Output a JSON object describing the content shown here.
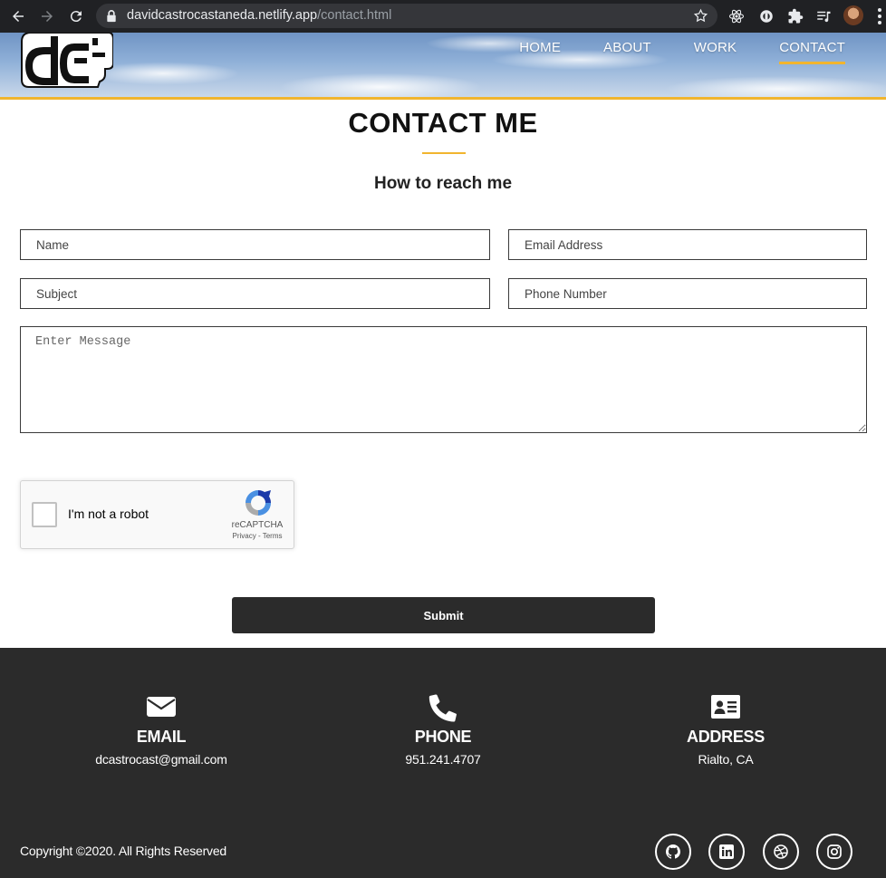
{
  "browser": {
    "url_host": "davidcastrocastaneda.netlify.app",
    "url_path": "/contact.html"
  },
  "nav": {
    "items": [
      "HOME",
      "ABOUT",
      "WORK",
      "CONTACT"
    ],
    "active": "CONTACT"
  },
  "page": {
    "title": "CONTACT ME",
    "subtitle": "How to reach me"
  },
  "form": {
    "name_placeholder": "Name",
    "email_placeholder": "Email Address",
    "subject_placeholder": "Subject",
    "phone_placeholder": "Phone Number",
    "message_placeholder": "Enter Message",
    "submit_label": "Submit"
  },
  "captcha": {
    "label": "I'm not a robot",
    "brand": "reCAPTCHA",
    "links": "Privacy - Terms"
  },
  "footer": {
    "email": {
      "heading": "EMAIL",
      "value": "dcastrocast@gmail.com",
      "icon": "envelope-icon"
    },
    "phone": {
      "heading": "PHONE",
      "value": "951.241.4707",
      "icon": "phone-icon"
    },
    "address": {
      "heading": "ADDRESS",
      "value": "Rialto, CA",
      "icon": "address-card-icon"
    },
    "copyright": "Copyright ©2020. All Rights Reserved",
    "social": [
      "github-icon",
      "linkedin-icon",
      "dribbble-icon",
      "instagram-icon"
    ]
  },
  "colors": {
    "accent": "#f1b52e",
    "footer_bg": "#2b2b2b",
    "browser_bg": "#202124"
  }
}
